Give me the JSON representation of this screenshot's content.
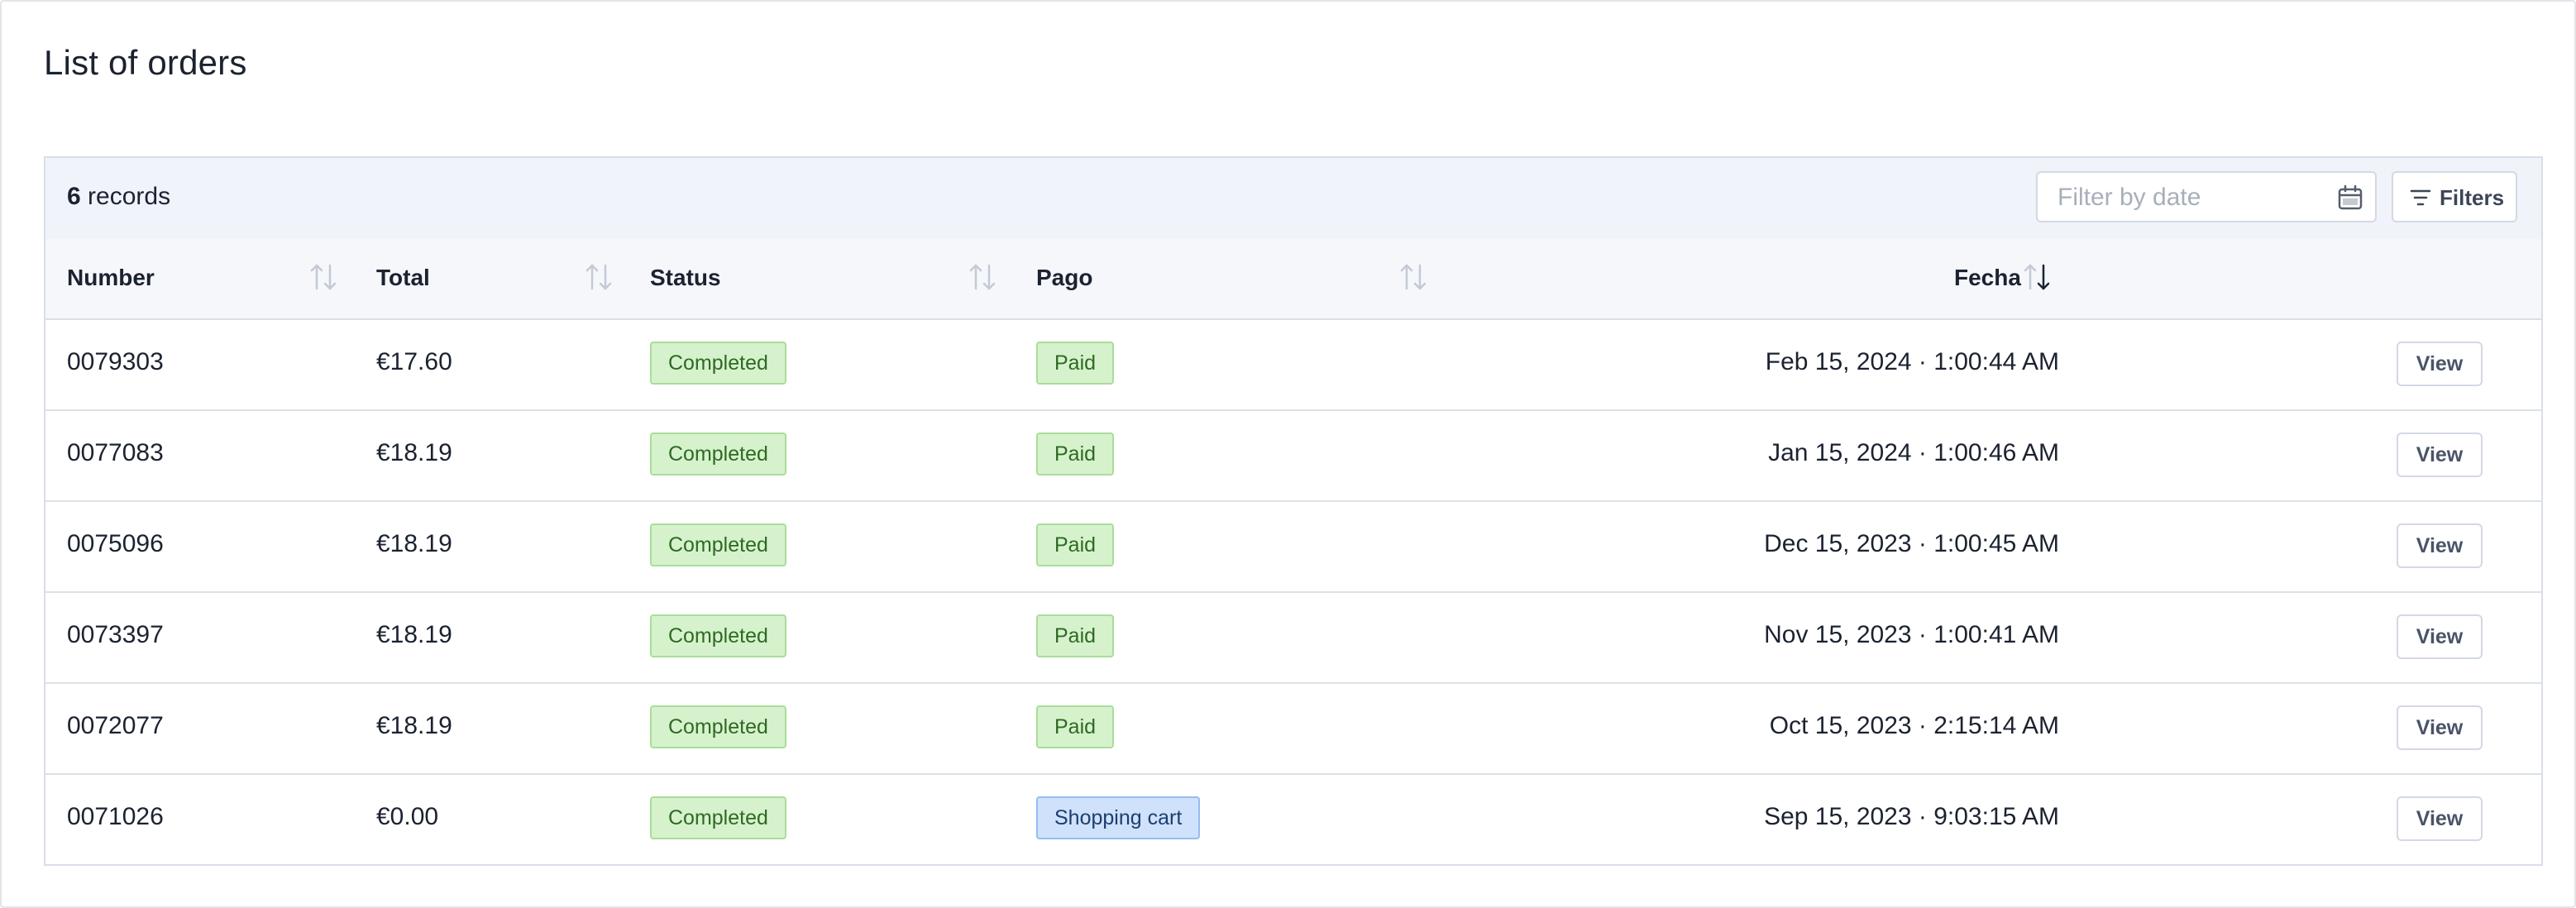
{
  "page": {
    "title": "List of orders"
  },
  "toolbar": {
    "record_count": "6",
    "record_label": "records",
    "date_filter_placeholder": "Filter by date",
    "date_filter_value": "",
    "filters_label": "Filters",
    "calendar_icon": "calendar-icon",
    "filters_icon": "filter-lines-icon"
  },
  "table": {
    "columns": [
      {
        "label": "Number",
        "sortable": true,
        "sort": "none"
      },
      {
        "label": "Total",
        "sortable": true,
        "sort": "none"
      },
      {
        "label": "Status",
        "sortable": true,
        "sort": "none"
      },
      {
        "label": "Pago",
        "sortable": true,
        "sort": "none"
      },
      {
        "label": "Fecha",
        "sortable": true,
        "sort": "descending"
      }
    ],
    "rows": [
      {
        "number": "0079303",
        "total": "€17.60",
        "status": "Completed",
        "payment": "Paid",
        "date": "Feb 15, 2024 · 1:00:44 AM",
        "action": "View"
      },
      {
        "number": "0077083",
        "total": "€18.19",
        "status": "Completed",
        "payment": "Paid",
        "date": "Jan 15, 2024 · 1:00:46 AM",
        "action": "View"
      },
      {
        "number": "0075096",
        "total": "€18.19",
        "status": "Completed",
        "payment": "Paid",
        "date": "Dec 15, 2023 · 1:00:45 AM",
        "action": "View"
      },
      {
        "number": "0073397",
        "total": "€18.19",
        "status": "Completed",
        "payment": "Paid",
        "date": "Nov 15, 2023 · 1:00:41 AM",
        "action": "View"
      },
      {
        "number": "0072077",
        "total": "€18.19",
        "status": "Completed",
        "payment": "Paid",
        "date": "Oct 15, 2023 · 2:15:14 AM",
        "action": "View"
      },
      {
        "number": "0071026",
        "total": "€0.00",
        "status": "Completed",
        "payment": "Shopping cart",
        "date": "Sep 15, 2023 · 9:03:15 AM",
        "action": "View"
      }
    ]
  },
  "colors": {
    "status_completed_bg": "#d6f2cd",
    "status_completed_text": "#2e6a22",
    "payment_cart_bg": "#cfe1fb",
    "payment_cart_text": "#1c3e6e",
    "header_bg": "#f0f3fa",
    "border": "#d9dee7"
  }
}
